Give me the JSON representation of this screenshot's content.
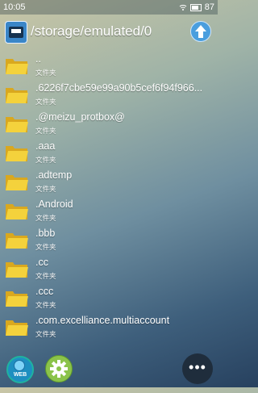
{
  "status_bar": {
    "time": "10:05",
    "battery": "87"
  },
  "header": {
    "path": "/storage/emulated/0"
  },
  "files": [
    {
      "name": "..",
      "type": "文件夹"
    },
    {
      "name": ".6226f7cbe59e99a90b5cef6f94f966...",
      "type": "文件夹"
    },
    {
      "name": ".@meizu_protbox@",
      "type": "文件夹"
    },
    {
      "name": ".aaa",
      "type": "文件夹"
    },
    {
      "name": ".adtemp",
      "type": "文件夹"
    },
    {
      "name": ".Android",
      "type": "文件夹"
    },
    {
      "name": ".bbb",
      "type": "文件夹"
    },
    {
      "name": ".cc",
      "type": "文件夹"
    },
    {
      "name": ".ccc",
      "type": "文件夹"
    },
    {
      "name": ".com.excelliance.multiaccount",
      "type": "文件夹"
    }
  ],
  "bottom": {
    "web_label": "WEB",
    "more_label": "•••"
  },
  "colors": {
    "folder": "#f2cf3a",
    "accent": "#4a9ede",
    "settings": "#8bc34a"
  }
}
